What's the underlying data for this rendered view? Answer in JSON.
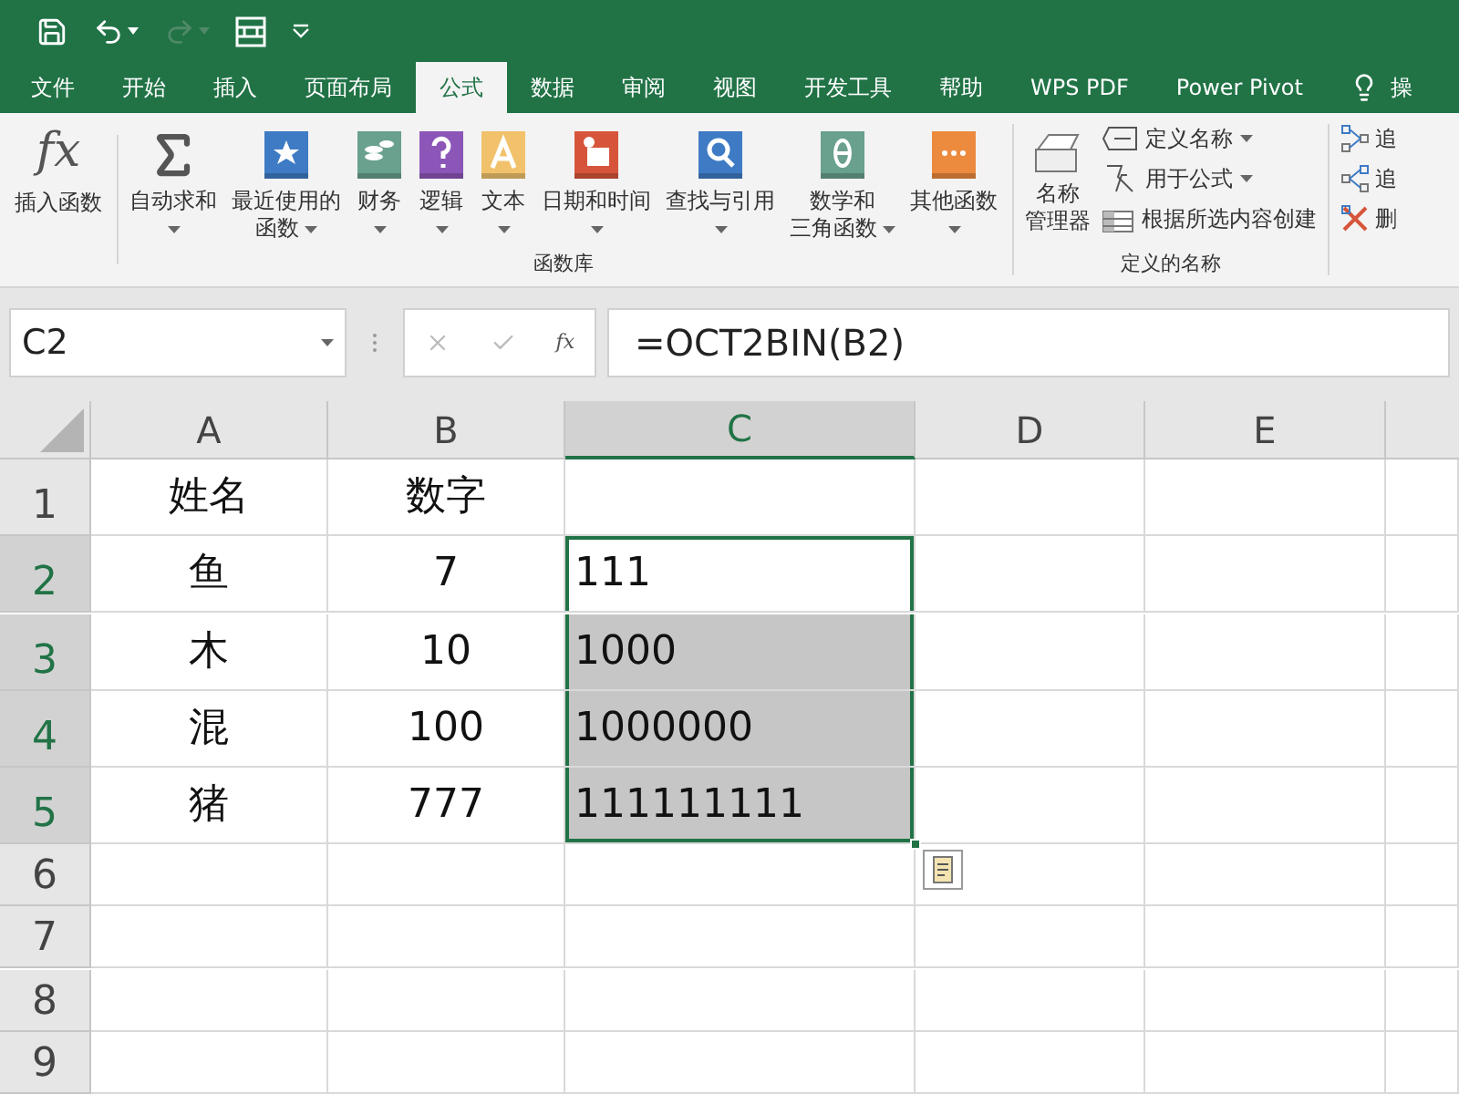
{
  "quick_access": [
    {
      "kind": "save",
      "disabled": false
    },
    {
      "kind": "undo",
      "disabled": false
    },
    {
      "kind": "redo",
      "disabled": true
    },
    {
      "kind": "form",
      "disabled": false
    },
    {
      "kind": "customize",
      "disabled": false
    }
  ],
  "tabs": [
    {
      "label": "文件",
      "selected": false
    },
    {
      "label": "开始",
      "selected": false
    },
    {
      "label": "插入",
      "selected": false
    },
    {
      "label": "页面布局",
      "selected": false
    },
    {
      "label": "公式",
      "selected": true
    },
    {
      "label": "数据",
      "selected": false
    },
    {
      "label": "审阅",
      "selected": false
    },
    {
      "label": "视图",
      "selected": false
    },
    {
      "label": "开发工具",
      "selected": false
    },
    {
      "label": "帮助",
      "selected": false
    },
    {
      "label": "WPS PDF",
      "selected": false
    },
    {
      "label": "Power Pivot",
      "selected": false
    },
    {
      "label": "操",
      "selected": false,
      "kind": "tell"
    }
  ],
  "ribbon": {
    "insert_function": {
      "icon_text": "fx",
      "label": "插入函数"
    },
    "function_library": {
      "label": "函数库",
      "items": [
        {
          "lines": [
            "自动求和"
          ],
          "dropdown": true
        },
        {
          "lines": [
            "最近使用的",
            "函数"
          ],
          "dropdown": true
        },
        {
          "lines": [
            "财务"
          ],
          "dropdown": true
        },
        {
          "lines": [
            "逻辑"
          ],
          "dropdown": true
        },
        {
          "lines": [
            "文本"
          ],
          "dropdown": true
        },
        {
          "lines": [
            "日期和时间"
          ],
          "dropdown": true
        },
        {
          "lines": [
            "查找与引用"
          ],
          "dropdown": true
        },
        {
          "lines": [
            "数学和",
            "三角函数"
          ],
          "dropdown": true
        },
        {
          "lines": [
            "其他函数"
          ],
          "dropdown": true
        }
      ]
    },
    "defined_names": {
      "label": "定义的名称",
      "manager": [
        "名称",
        "管理器"
      ],
      "items": [
        {
          "label": "定义名称",
          "dropdown": true
        },
        {
          "label": "用于公式",
          "dropdown": true
        },
        {
          "label": "根据所选内容创建",
          "dropdown": false
        }
      ]
    },
    "auditing": {
      "items": [
        {
          "label": "追"
        },
        {
          "label": "追"
        },
        {
          "label": "删"
        }
      ]
    }
  },
  "formula_bar": {
    "name_box": "C2",
    "fx_label": "fx",
    "formula": "=OCT2BIN(B2)"
  },
  "sheet": {
    "columns": [
      {
        "label": "A",
        "selected": false
      },
      {
        "label": "B",
        "selected": false
      },
      {
        "label": "C",
        "selected": true
      },
      {
        "label": "D",
        "selected": false
      },
      {
        "label": "E",
        "selected": false
      }
    ],
    "rows": [
      {
        "label": "1",
        "selected": false,
        "cells": [
          {
            "value": "姓名",
            "selected": false
          },
          {
            "value": "数字",
            "selected": false
          },
          {
            "selected": false
          }
        ]
      },
      {
        "label": "2",
        "selected": true,
        "cells": [
          {
            "value": "鱼",
            "selected": false
          },
          {
            "value": "7",
            "selected": false
          },
          {
            "value": "111",
            "selected": true,
            "active": true
          }
        ]
      },
      {
        "label": "3",
        "selected": true,
        "cells": [
          {
            "value": "木",
            "selected": false
          },
          {
            "value": "10",
            "selected": false
          },
          {
            "value": "1000",
            "selected": true,
            "active": false
          }
        ]
      },
      {
        "label": "4",
        "selected": true,
        "cells": [
          {
            "value": "混",
            "selected": false
          },
          {
            "value": "100",
            "selected": false
          },
          {
            "value": "1000000",
            "selected": true,
            "active": false
          }
        ]
      },
      {
        "label": "5",
        "selected": true,
        "cells": [
          {
            "value": "猪",
            "selected": false
          },
          {
            "value": "777",
            "selected": false
          },
          {
            "value": "111111111",
            "selected": true,
            "active": false
          }
        ]
      },
      {
        "label": "6",
        "selected": false,
        "cells": []
      },
      {
        "label": "7",
        "selected": false,
        "cells": []
      },
      {
        "label": "8",
        "selected": false,
        "cells": []
      },
      {
        "label": "9",
        "selected": false,
        "cells": []
      }
    ]
  }
}
